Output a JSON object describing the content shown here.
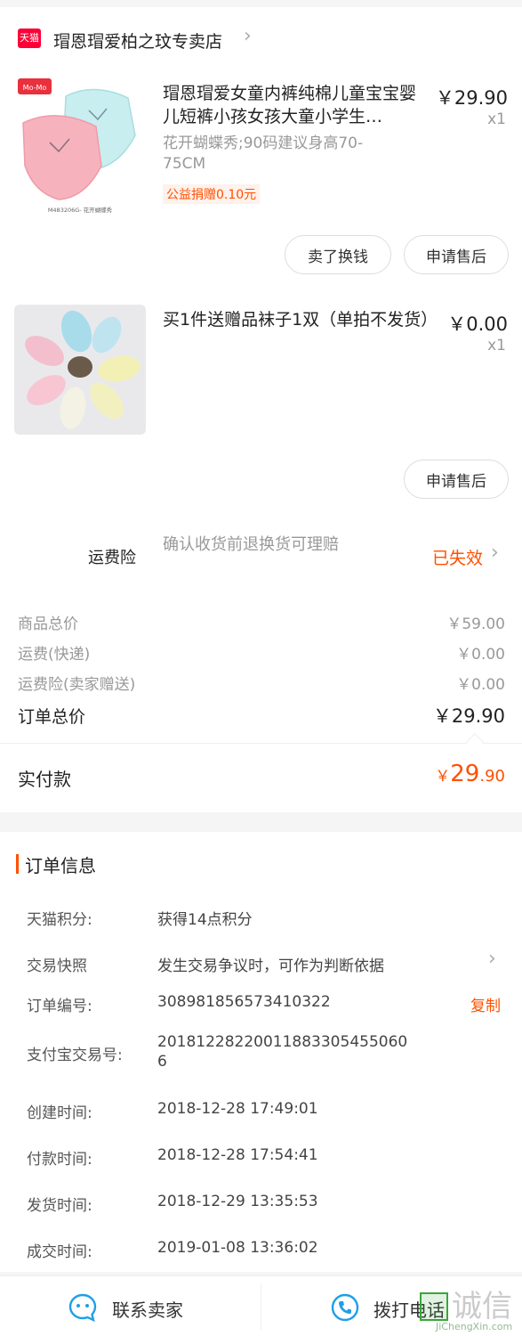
{
  "store": {
    "logo_text": "天猫",
    "name": "瑁恩瑁爱柏之玟专卖店"
  },
  "items": [
    {
      "title": "瑁恩瑁爱女童内裤纯棉儿童宝宝婴儿短裤小孩女孩大童小学生…",
      "price": "￥29.90",
      "qty": "x1",
      "sku": "花开蝴蝶秀;90码建议身高70-75CM",
      "tag": "公益捐赠0.10元",
      "thumb_brand": "Mo-Mo",
      "thumb_caption": "M483206G- 花开蝴蝶秀",
      "buttons": [
        "卖了换钱",
        "申请售后"
      ]
    },
    {
      "title": "买1件送赠品袜子1双（单拍不发货）",
      "price": "￥0.00",
      "qty": "x1",
      "buttons": [
        "申请售后"
      ]
    }
  ],
  "freight_insurance": {
    "label": "运费险",
    "desc": "确认收货前退换货可理赔",
    "status": "已失效"
  },
  "summary": {
    "rows": [
      {
        "label": "商品总价",
        "value": "￥59.00"
      },
      {
        "label": "运费(快递)",
        "value": "￥0.00"
      },
      {
        "label": "运费险(卖家赠送)",
        "value": "￥0.00"
      }
    ],
    "total_label": "订单总价",
    "total_value": "￥29.90",
    "paid_label": "实付款",
    "paid_currency": "￥",
    "paid_int": "29",
    "paid_dec": ".90"
  },
  "order_info": {
    "title": "订单信息",
    "rows": [
      {
        "label": "天猫积分:",
        "value": "获得14点积分"
      },
      {
        "label": "交易快照",
        "value": "发生交易争议时，可作为判断依据"
      },
      {
        "label": "订单编号:",
        "value": "308981856573410322",
        "action": "复制"
      },
      {
        "label": "支付宝交易号:",
        "value": "20181228220011883305455060",
        "value2": "6"
      },
      {
        "label": "创建时间:",
        "value": "2018-12-28 17:49:01"
      },
      {
        "label": "付款时间:",
        "value": "2018-12-28 17:54:41"
      },
      {
        "label": "发货时间:",
        "value": "2018-12-29 13:35:53"
      },
      {
        "label": "成交时间:",
        "value": "2019-01-08 13:36:02"
      }
    ]
  },
  "bottom": {
    "contact_seller": "联系卖家",
    "call": "拨打电话"
  },
  "watermark": {
    "main": "诚信",
    "sub": "JiChengXin.com"
  },
  "colors": {
    "accent": "#ff5000",
    "tmall_red": "#ff0036",
    "icon_blue": "#1ea0e6"
  }
}
